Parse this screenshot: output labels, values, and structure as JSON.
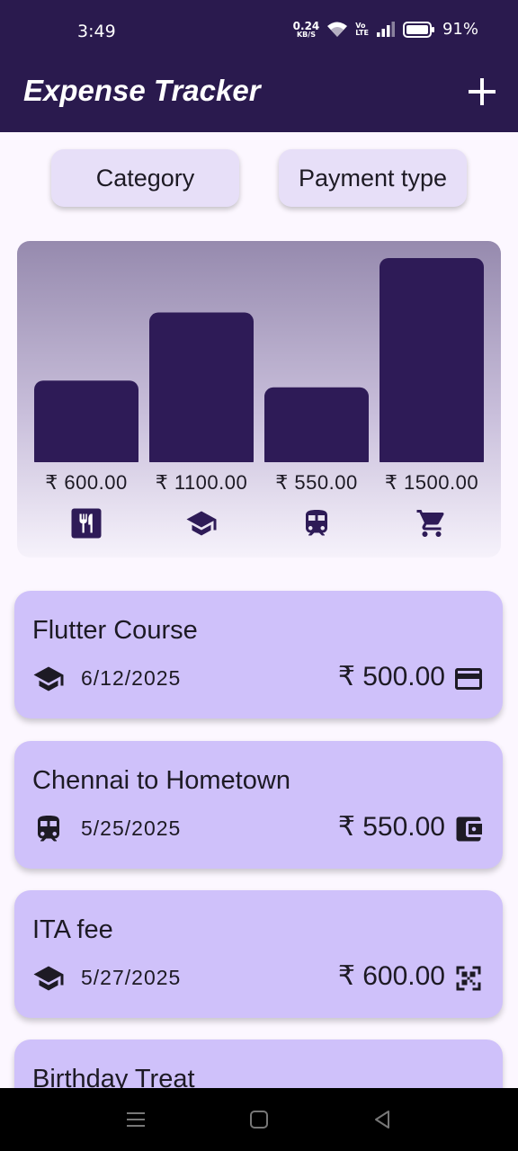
{
  "status_bar": {
    "time": "3:49",
    "net_speed_value": "0.24",
    "net_speed_unit": "KB/S",
    "volte_top": "Vo",
    "volte_bottom": "LTE",
    "battery_percent": "91%"
  },
  "app_bar": {
    "title": "Expense Tracker",
    "add_icon": "plus-icon"
  },
  "filters": {
    "category_label": "Category",
    "payment_type_label": "Payment type"
  },
  "chart_data": {
    "type": "bar",
    "categories": [
      "food",
      "education",
      "travel",
      "shopping"
    ],
    "values": [
      600,
      1100,
      550,
      1500
    ],
    "value_labels": [
      "₹ 600.00",
      "₹ 1100.00",
      "₹ 550.00",
      "₹ 1500.00"
    ],
    "category_icons": [
      "restaurant-icon",
      "school-icon",
      "train-icon",
      "cart-icon"
    ],
    "ylim": [
      0,
      1500
    ],
    "bar_color": "#2e1b57",
    "grid": false
  },
  "expenses": [
    {
      "title": "Flutter Course",
      "date": "6/12/2025",
      "amount": "₹ 500.00",
      "category_icon": "school-icon",
      "payment_icon": "card-icon"
    },
    {
      "title": "Chennai to Hometown",
      "date": "5/25/2025",
      "amount": "₹ 550.00",
      "category_icon": "train-icon",
      "payment_icon": "wallet-icon"
    },
    {
      "title": "ITA fee",
      "date": "5/27/2025",
      "amount": "₹ 600.00",
      "category_icon": "school-icon",
      "payment_icon": "qr-code-icon"
    },
    {
      "title": "Birthday Treat"
    }
  ],
  "colors": {
    "app_bar": "#2a1a4e",
    "background": "#fcf7ff",
    "card": "#cfc1fa",
    "filter_button": "#e7dff8",
    "bar": "#2e1b57"
  }
}
